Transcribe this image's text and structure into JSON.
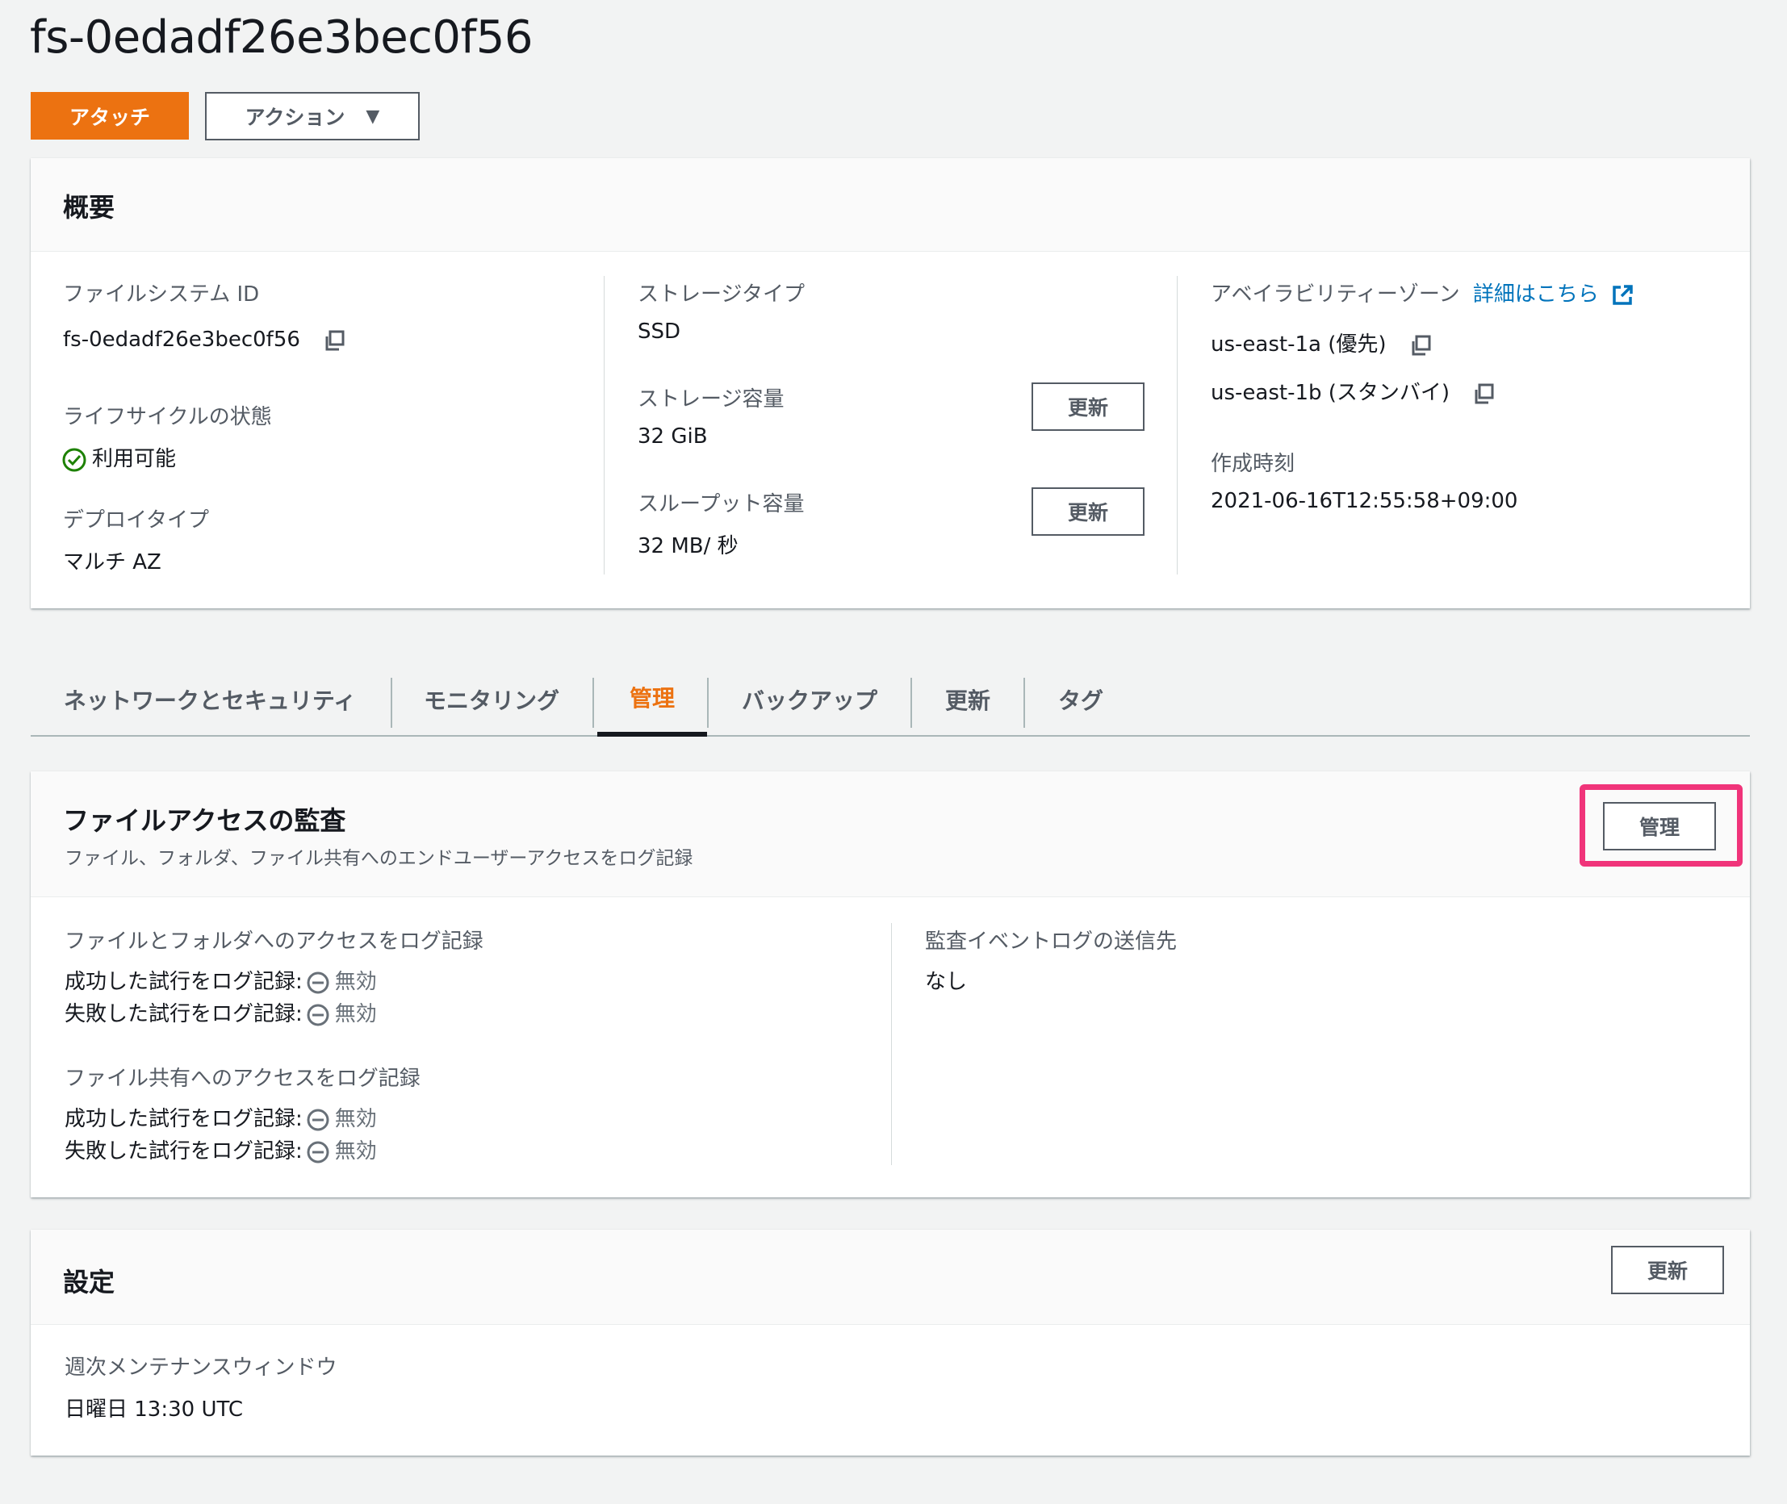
{
  "page": {
    "title": "fs-0edadf26e3bec0f56",
    "attach_label": "アタッチ",
    "actions_label": "アクション",
    "actions_caret": "▼"
  },
  "overview": {
    "title": "概要",
    "fs_id_label": "ファイルシステム ID",
    "fs_id_value": "fs-0edadf26e3bec0f56",
    "lifecycle_label": "ライフサイクルの状態",
    "lifecycle_value": "利用可能",
    "deploy_label": "デプロイタイプ",
    "deploy_value": "マルチ AZ",
    "storage_type_label": "ストレージタイプ",
    "storage_type_value": "SSD",
    "storage_capacity_label": "ストレージ容量",
    "storage_capacity_value": "32 GiB",
    "throughput_label": "スループット容量",
    "throughput_value": "32 MB/ 秒",
    "update_label": "更新",
    "az_label": "アベイラビリティーゾーン",
    "az_link": "詳細はこちら",
    "az_primary": "us-east-1a (優先)",
    "az_standby": "us-east-1b (スタンバイ)",
    "created_label": "作成時刻",
    "created_value": "2021-06-16T12:55:58+09:00"
  },
  "tabs": [
    "ネットワークとセキュリティ",
    "モニタリング",
    "管理",
    "バックアップ",
    "更新",
    "タグ"
  ],
  "audit": {
    "title": "ファイルアクセスの監査",
    "subtitle": "ファイル、フォルダ、ファイル共有へのエンドユーザーアクセスをログ記録",
    "manage_label": "管理",
    "files_label": "ファイルとフォルダへのアクセスをログ記録",
    "success_label": "成功した試行をログ記録:",
    "failure_label": "失敗した試行をログ記録:",
    "disabled": "無効",
    "shares_label": "ファイル共有へのアクセスをログ記録",
    "destination_label": "監査イベントログの送信先",
    "destination_value": "なし"
  },
  "settings": {
    "title": "設定",
    "update_label": "更新",
    "maintenance_label": "週次メンテナンスウィンドウ",
    "maintenance_value": "日曜日 13:30 UTC"
  },
  "colors": {
    "accent": "#ec7211",
    "link": "#0073bb",
    "success": "#1d8102",
    "highlight": "#f0347a"
  }
}
